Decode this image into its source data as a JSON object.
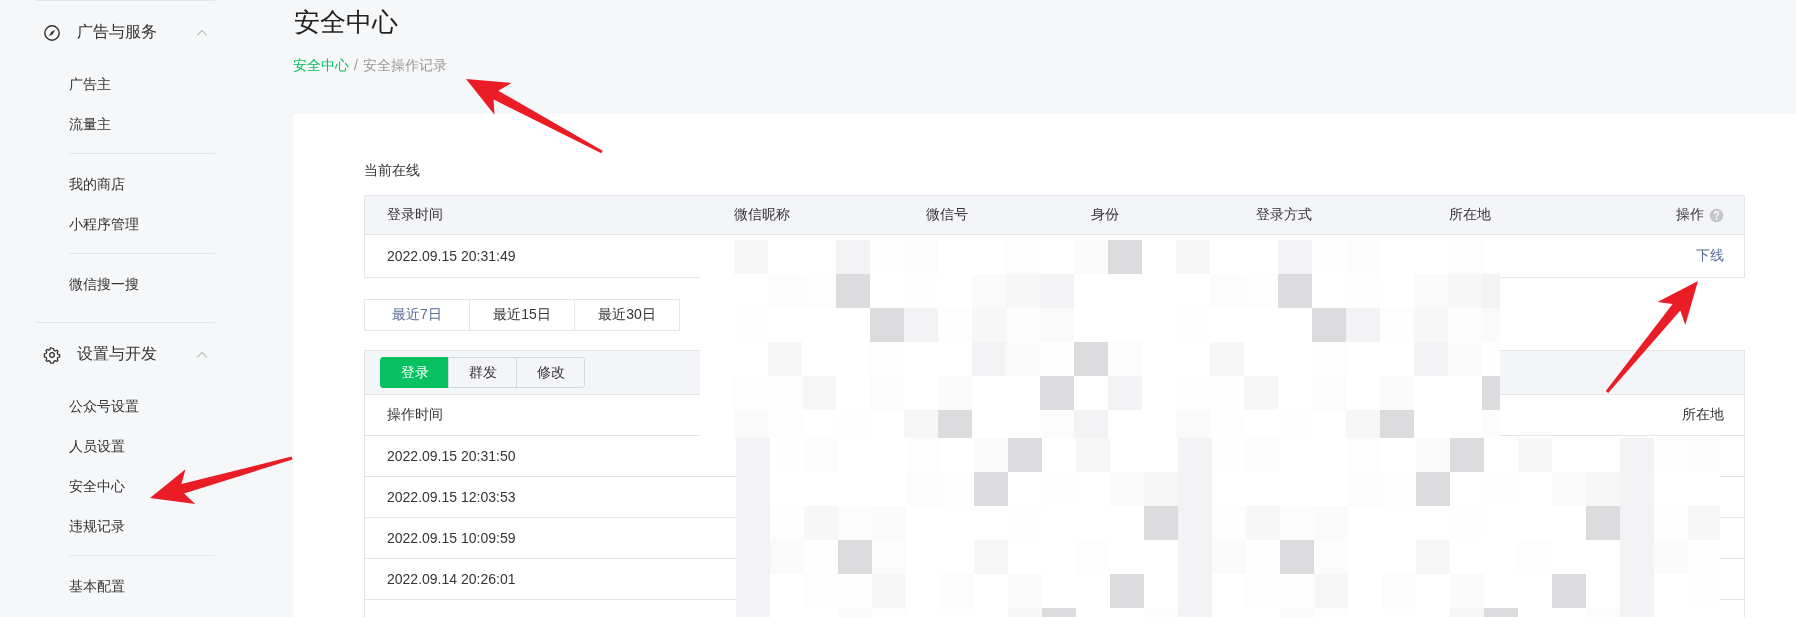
{
  "sidebar": {
    "groups": [
      {
        "title": "广告与服务",
        "expanded": true,
        "sections": [
          [
            {
              "label": "广告主"
            },
            {
              "label": "流量主"
            }
          ],
          [
            {
              "label": "我的商店"
            },
            {
              "label": "小程序管理"
            }
          ],
          [
            {
              "label": "微信搜一搜"
            }
          ]
        ]
      },
      {
        "title": "设置与开发",
        "expanded": true,
        "sections": [
          [
            {
              "label": "公众号设置"
            },
            {
              "label": "人员设置"
            },
            {
              "label": "安全中心"
            },
            {
              "label": "违规记录"
            }
          ],
          [
            {
              "label": "基本配置"
            }
          ]
        ]
      }
    ]
  },
  "page_title": "安全中心",
  "breadcrumb": {
    "items": [
      {
        "label": "安全中心",
        "link": true
      },
      {
        "label": "安全操作记录",
        "link": false
      }
    ],
    "separator": "/"
  },
  "online": {
    "title": "当前在线",
    "columns": [
      "登录时间",
      "微信昵称",
      "微信号",
      "身份",
      "登录方式",
      "所在地",
      "操作"
    ],
    "rows": [
      {
        "login_time": "2022.09.15 20:31:49",
        "action": "下线"
      }
    ]
  },
  "ranges": [
    {
      "label": "最近7日",
      "selected": true
    },
    {
      "label": "最近15日",
      "selected": false
    },
    {
      "label": "最近30日",
      "selected": false
    }
  ],
  "log": {
    "tabs": [
      {
        "label": "登录",
        "selected": true
      },
      {
        "label": "群发",
        "selected": false
      },
      {
        "label": "修改",
        "selected": false
      }
    ],
    "columns": [
      "操作时间",
      "所在地"
    ],
    "rows": [
      {
        "time": "2022.09.15 20:31:50"
      },
      {
        "time": "2022.09.15 12:03:53"
      },
      {
        "time": "2022.09.15 10:09:59"
      },
      {
        "time": "2022.09.14 20:26:01"
      }
    ]
  }
}
